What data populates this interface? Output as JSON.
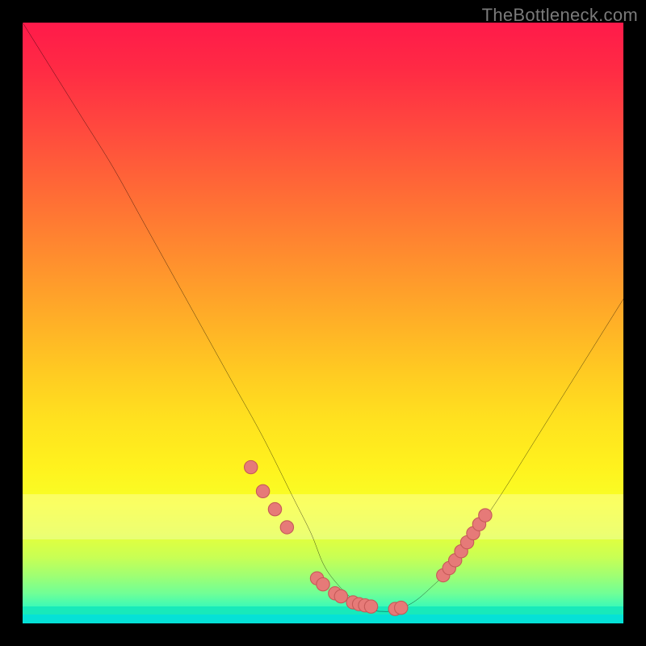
{
  "watermark": "TheBottleneck.com",
  "colors": {
    "page_bg": "#000000",
    "gradient_top": "#ff1a4a",
    "gradient_mid": "#ffe11f",
    "gradient_bottom": "#05e5d8",
    "curve_stroke": "#000000",
    "marker_fill": "#e67a78",
    "marker_stroke": "#c65a58",
    "watermark_text": "#7a7a7a"
  },
  "chart_data": {
    "type": "line",
    "title": "",
    "xlabel": "",
    "ylabel": "",
    "xlim": [
      0,
      100
    ],
    "ylim": [
      0,
      100
    ],
    "grid": false,
    "legend": false,
    "series": [
      {
        "name": "bottleneck-curve",
        "x": [
          0,
          5,
          10,
          15,
          20,
          25,
          30,
          35,
          40,
          45,
          48,
          50,
          52,
          55,
          58,
          60,
          62,
          65,
          68,
          72,
          76,
          80,
          85,
          90,
          95,
          100
        ],
        "y": [
          100,
          92,
          84,
          76,
          67,
          58,
          49,
          40,
          31,
          21,
          15,
          10,
          7,
          4,
          2.3,
          2,
          2.2,
          3.5,
          6,
          10,
          16,
          22,
          30,
          38,
          46,
          54
        ]
      }
    ],
    "markers": {
      "name": "highlighted-points",
      "x": [
        38,
        40,
        42,
        44,
        49,
        50,
        52,
        53,
        55,
        56,
        57,
        58,
        62,
        63,
        70,
        71,
        72,
        73,
        74,
        75,
        76,
        77
      ],
      "y": [
        26,
        22,
        19,
        16,
        7.5,
        6.5,
        5,
        4.5,
        3.5,
        3.2,
        3,
        2.8,
        2.4,
        2.6,
        8,
        9.2,
        10.5,
        12,
        13.5,
        15,
        16.5,
        18
      ]
    },
    "background_gradient_stops": [
      {
        "pos": 0,
        "color": "#ff1a4a"
      },
      {
        "pos": 50,
        "color": "#ffca22"
      },
      {
        "pos": 80,
        "color": "#fff21e"
      },
      {
        "pos": 100,
        "color": "#05e5d8"
      }
    ]
  }
}
